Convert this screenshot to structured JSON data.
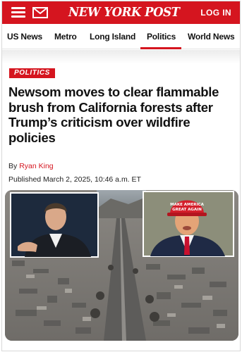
{
  "header": {
    "logo_text": "NEW YORK POST",
    "login_label": "LOG IN",
    "menu_icon": "hamburger-menu-icon",
    "mail_icon": "mail-icon",
    "brand_color": "#d5151f"
  },
  "nav": {
    "items": [
      {
        "label": "US News"
      },
      {
        "label": "Metro"
      },
      {
        "label": "Long Island"
      },
      {
        "label": "Politics",
        "active": true
      },
      {
        "label": "World News"
      }
    ]
  },
  "article": {
    "section_tag": "POLITICS",
    "headline": "Newsom moves to clear flammable brush from California forests after Trump’s criticism over wildfire policies",
    "byline_prefix": "By",
    "author": "Ryan King",
    "published": "Published March 2, 2025, 10:46 a.m. ET",
    "hat_text_line1": "MAKE AMERICA",
    "hat_text_line2": "GREAT AGAIN"
  }
}
